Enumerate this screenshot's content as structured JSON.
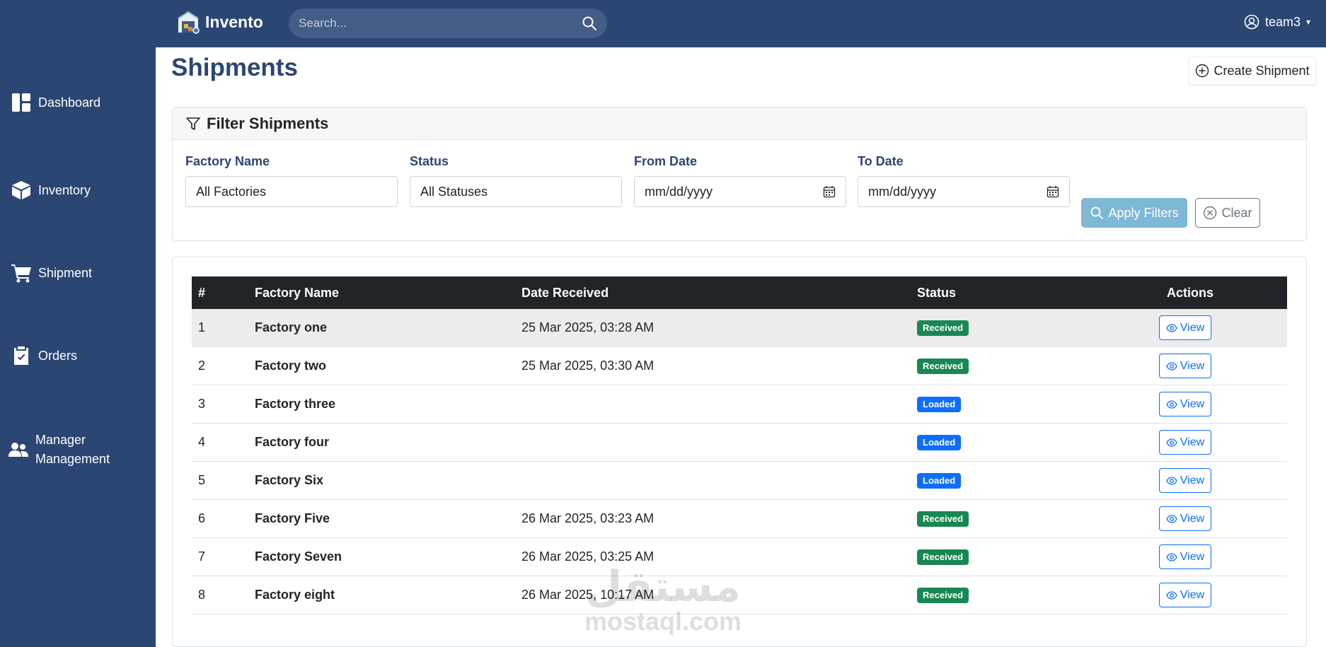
{
  "app": {
    "name": "Invento"
  },
  "search": {
    "placeholder": "Search..."
  },
  "user": {
    "name": "team3"
  },
  "sidebar": {
    "items": [
      {
        "label": "Dashboard",
        "icon": "dashboard-icon"
      },
      {
        "label": "Inventory",
        "icon": "box-icon"
      },
      {
        "label": "Shipment",
        "icon": "cart-icon"
      },
      {
        "label": "Orders",
        "icon": "clipboard-check-icon"
      },
      {
        "label": "Manager Management",
        "icon": "people-icon"
      }
    ]
  },
  "page": {
    "title": "Shipments",
    "create_label": "Create Shipment"
  },
  "filters": {
    "title": "Filter Shipments",
    "factory": {
      "label": "Factory Name",
      "value": "All Factories"
    },
    "status": {
      "label": "Status",
      "value": "All Statuses"
    },
    "from": {
      "label": "From Date",
      "value": "mm/dd/yyyy"
    },
    "to": {
      "label": "To Date",
      "value": "mm/dd/yyyy"
    },
    "apply_label": "Apply Filters",
    "clear_label": "Clear"
  },
  "table": {
    "headers": [
      "#",
      "Factory Name",
      "Date Received",
      "Status",
      "Actions"
    ],
    "view_label": "View",
    "rows": [
      {
        "num": "1",
        "factory": "Factory one",
        "date": "25 Mar 2025, 03:28 AM",
        "status": "Received"
      },
      {
        "num": "2",
        "factory": "Factory two",
        "date": "25 Mar 2025, 03:30 AM",
        "status": "Received"
      },
      {
        "num": "3",
        "factory": "Factory three",
        "date": "",
        "status": "Loaded"
      },
      {
        "num": "4",
        "factory": "Factory four",
        "date": "",
        "status": "Loaded"
      },
      {
        "num": "5",
        "factory": "Factory Six",
        "date": "",
        "status": "Loaded"
      },
      {
        "num": "6",
        "factory": "Factory Five",
        "date": "26 Mar 2025, 03:23 AM",
        "status": "Received"
      },
      {
        "num": "7",
        "factory": "Factory Seven",
        "date": "26 Mar 2025, 03:25 AM",
        "status": "Received"
      },
      {
        "num": "8",
        "factory": "Factory eight",
        "date": "26 Mar 2025, 10:17 AM",
        "status": "Received"
      }
    ]
  },
  "status_colors": {
    "Received": "#198754",
    "Loaded": "#0d6efd"
  },
  "colors": {
    "brand": "#2c4673",
    "apply": "#7fb7d6"
  },
  "watermark": {
    "arabic": "مستقل",
    "latin": "mostaql.com"
  }
}
